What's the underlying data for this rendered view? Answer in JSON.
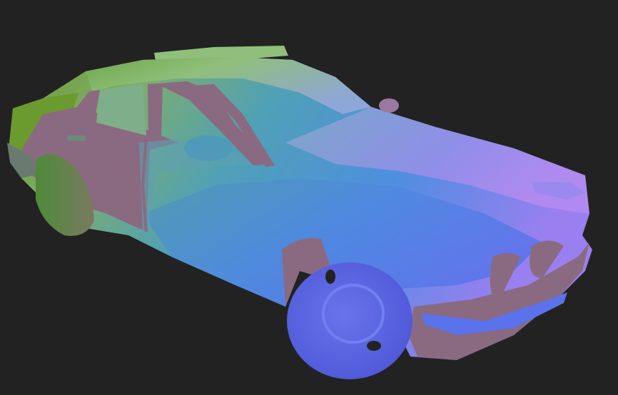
{
  "scene": {
    "subject": "car",
    "render_style": "surface-normal shading",
    "colors": {
      "background": "#222222",
      "rear_green": "#6b9a2e",
      "roof_green": "#8fbf7a",
      "body_teal": "#4fa0b8",
      "body_blue": "#4f8ee0",
      "front_violet": "#9a7ff0",
      "wheel_blue": "#5a6be6",
      "trim_mauve": "#8a6a80"
    }
  }
}
